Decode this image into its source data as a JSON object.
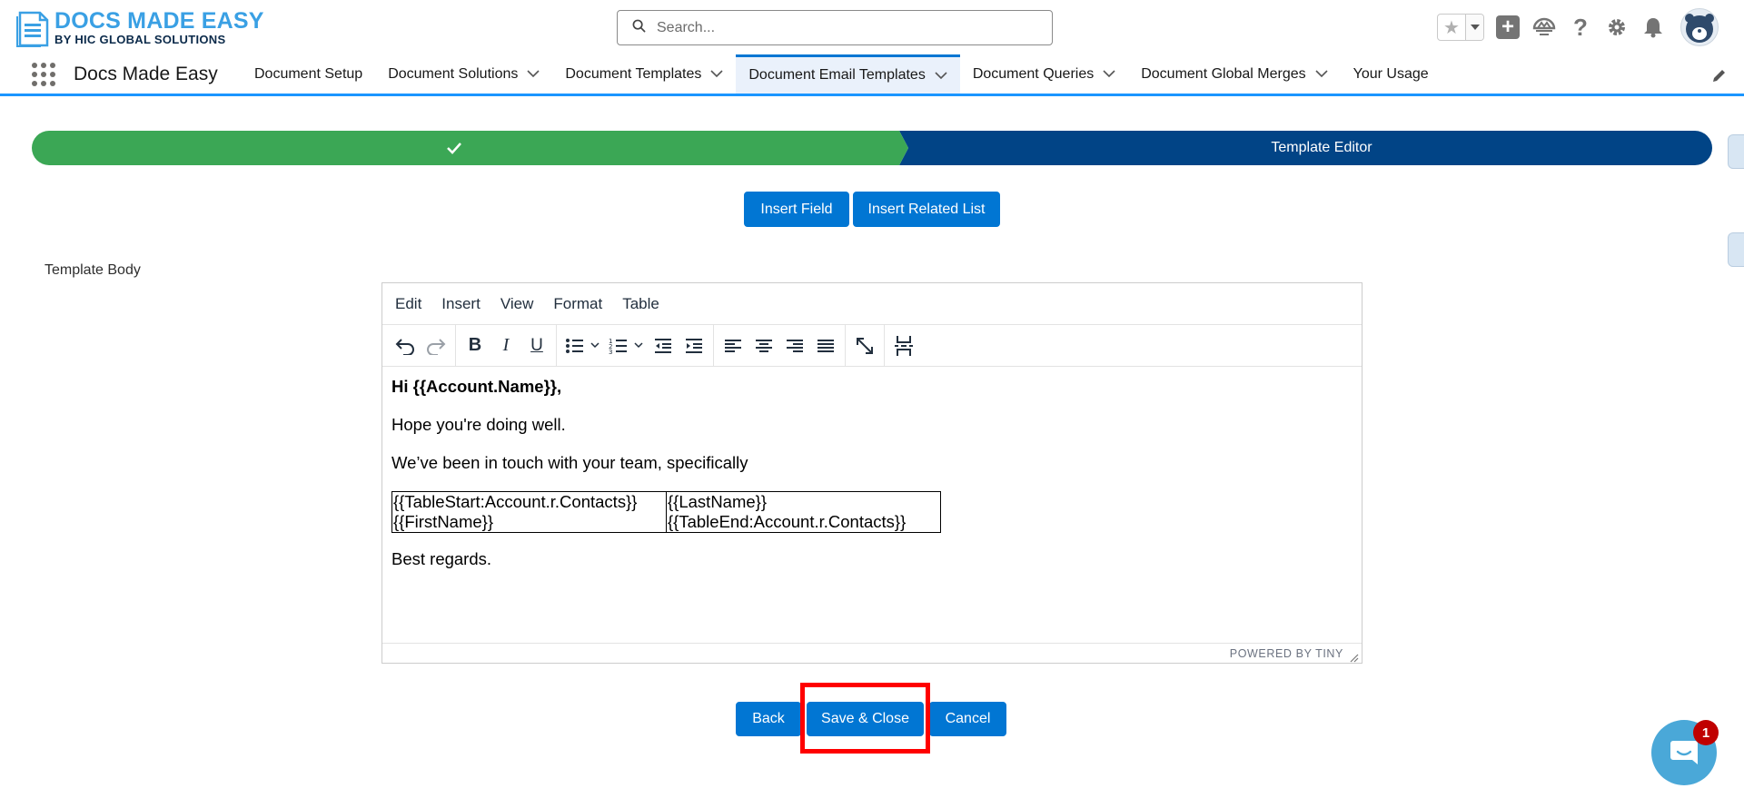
{
  "header": {
    "logo_title": "DOCS MADE EASY",
    "logo_subtitle": "BY HIC GLOBAL SOLUTIONS",
    "search_placeholder": "Search..."
  },
  "nav": {
    "app_name": "Docs Made Easy",
    "items": [
      {
        "label": "Document Setup",
        "has_menu": false
      },
      {
        "label": "Document Solutions",
        "has_menu": true
      },
      {
        "label": "Document Templates",
        "has_menu": true
      },
      {
        "label": "Document Email Templates",
        "has_menu": true,
        "active": true
      },
      {
        "label": "Document Queries",
        "has_menu": true
      },
      {
        "label": "Document Global Merges",
        "has_menu": true
      },
      {
        "label": "Your Usage",
        "has_menu": false
      }
    ]
  },
  "path": {
    "current_step": "Template Editor",
    "completed_color": "#3ba755",
    "current_color": "#014486"
  },
  "actions": {
    "insert_field": "Insert Field",
    "insert_related_list": "Insert Related List"
  },
  "template_body_label": "Template Body",
  "editor": {
    "menu": [
      "Edit",
      "Insert",
      "View",
      "Format",
      "Table"
    ],
    "content": {
      "greeting": "Hi {{Account.Name}},",
      "line1": "Hope you're doing well.",
      "line2": "We’ve been in touch with your team, specifically",
      "table": [
        [
          "{{TableStart:Account.r.Contacts}} {{FirstName}}",
          "{{LastName}} {{TableEnd:Account.r.Contacts}}"
        ]
      ],
      "closing": "Best regards."
    },
    "powered_by": "POWERED BY TINY"
  },
  "footer_buttons": {
    "back": "Back",
    "save_close": "Save & Close",
    "cancel": "Cancel"
  },
  "chat": {
    "badge_count": "1"
  },
  "colors": {
    "brand_blue": "#0176d3",
    "highlight": "#ff0000"
  }
}
